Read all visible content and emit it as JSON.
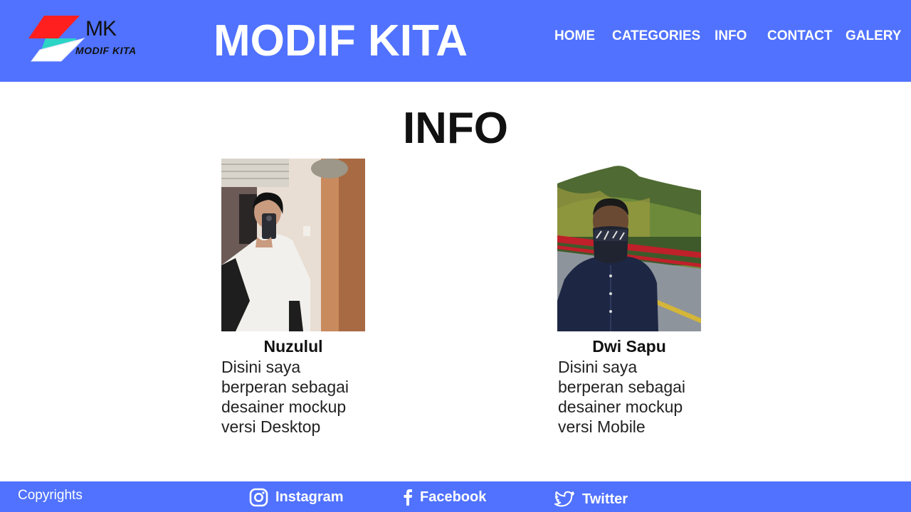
{
  "colors": {
    "brand_blue": "#5072fe",
    "logo_red": "#ff1f1f",
    "logo_teal": "#2bd4c4"
  },
  "logo": {
    "mark": "MK",
    "text": "MODIF KITA"
  },
  "header": {
    "title": "MODIF KITA"
  },
  "nav": {
    "home": "HOME",
    "categories": "CATEGORIES",
    "info": "INFO",
    "contact": "CONTACT",
    "galery": "GALERY"
  },
  "main": {
    "heading": "INFO",
    "people": [
      {
        "name": "Nuzulul",
        "description": "Disini saya berperan sebagai desainer mockup versi Desktop"
      },
      {
        "name": "Dwi Sapu",
        "description": "Disini saya berperan sebagai desainer mockup versi Mobile"
      }
    ]
  },
  "footer": {
    "copyright": "Copyrights",
    "instagram": {
      "label": "Instagram",
      "icon": "instagram-icon"
    },
    "facebook": {
      "label": "Facebook",
      "icon": "facebook-icon"
    },
    "twitter": {
      "label": "Twitter",
      "icon": "twitter-icon"
    }
  }
}
